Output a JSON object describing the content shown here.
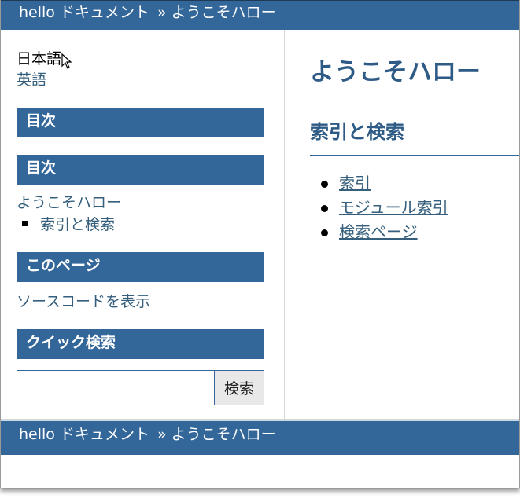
{
  "breadcrumb": {
    "project": "hello ドキュメント",
    "separator": "»",
    "current": "ようこそハロー"
  },
  "sidebar": {
    "languages": {
      "current": "日本語",
      "other": "英語"
    },
    "toc_heading_1": "目次",
    "toc_heading_2": "目次",
    "toc": {
      "root": "ようこそハロー",
      "children": [
        "索引と検索"
      ]
    },
    "this_page_heading": "このページ",
    "show_source": "ソースコードを表示",
    "quick_search_heading": "クイック検索",
    "search": {
      "value": "",
      "button_label": "検索"
    }
  },
  "main": {
    "title": "ようこそハロー",
    "section_title": "索引と検索",
    "links": [
      "索引",
      "モジュール索引",
      "検索ページ"
    ]
  },
  "icons": [
    "mouse-cursor-icon"
  ],
  "colors": {
    "bar": "#336699",
    "link": "#355f7c",
    "heading": "#2e5a86"
  }
}
